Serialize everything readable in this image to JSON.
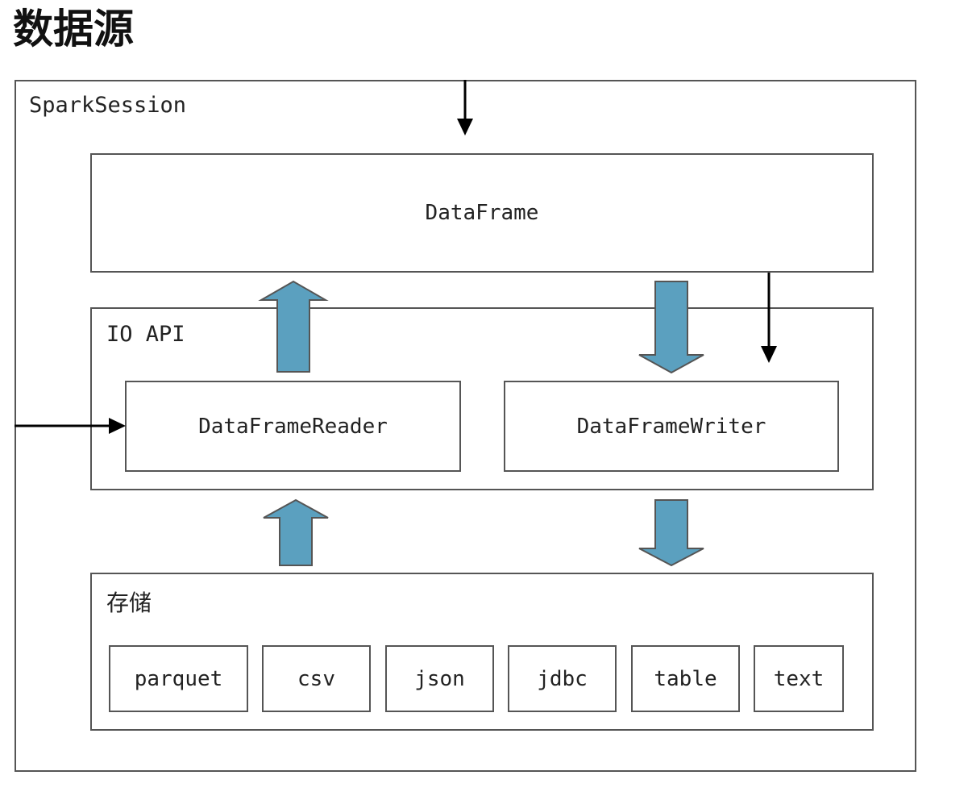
{
  "page": {
    "title": "数据源"
  },
  "diagram": {
    "container": {
      "label": "SparkSession"
    },
    "dataframe": {
      "label": "DataFrame"
    },
    "io_api": {
      "label": "IO API",
      "reader": "DataFrameReader",
      "writer": "DataFrameWriter"
    },
    "storage": {
      "label": "存储",
      "formats": [
        "parquet",
        "csv",
        "json",
        "jdbc",
        "table",
        "text"
      ]
    },
    "colors": {
      "block_arrow_fill": "#5ba0bf",
      "border": "#555555",
      "line": "#000000"
    }
  }
}
